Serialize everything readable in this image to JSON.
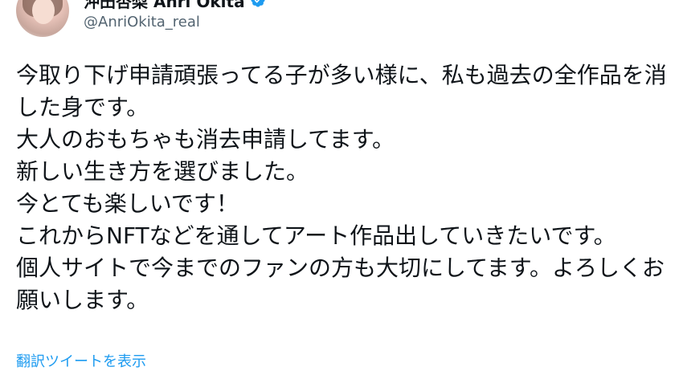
{
  "author": {
    "display_name": "沖田杏梨 Anri Okita",
    "handle": "@AnriOkita_real",
    "avatar_icon": "user-avatar",
    "verified_icon": "verified-badge-icon"
  },
  "menu": {
    "more_icon": "more-options-icon"
  },
  "tweet": {
    "lines": [
      "今取り下げ申請頑張ってる子が多い様に、私も過去の全作品を消した身です。",
      "大人のおもちゃも消去申請してます。",
      "新しい生き方を選びました。",
      "今とても楽しいです！",
      "これからNFTなどを通してアート作品出していきたいです。",
      "個人サイトで今までのファンの方も大切にしてます。よろしくお願いします。"
    ]
  },
  "translate": {
    "label": "翻訳ツイートを表示"
  },
  "colors": {
    "text": "#0f1419",
    "secondary": "#536471",
    "link": "#1d9bf0",
    "verified": "#1d9bf0",
    "background": "#ffffff"
  }
}
